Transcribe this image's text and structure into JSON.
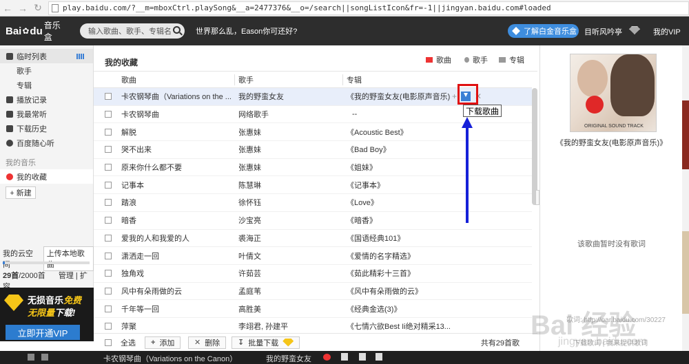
{
  "browser": {
    "url": "play.baidu.com/?__m=mboxCtrl.playSong&__a=2477376&__o=/search||songListIcon&fr=-1||jingyan.baidu.com#loaded"
  },
  "topbar": {
    "logo_text": "Bai",
    "logo_text2": "du",
    "logo_product": "音乐盒",
    "search_placeholder": "输入歌曲、歌手、专辑名",
    "hot_phrase": "世界那么乱，Eason你可还好?",
    "vip_pill": "了解白金音乐盒",
    "username": "目听风吟亭",
    "my_vip": "我的VIP"
  },
  "sidebar": {
    "items": [
      {
        "label": "临时列表"
      },
      {
        "label": "歌手"
      },
      {
        "label": "专辑"
      },
      {
        "label": "播放记录"
      },
      {
        "label": "我最常听"
      },
      {
        "label": "下载历史"
      },
      {
        "label": "百度随心听"
      }
    ],
    "my_music_label": "我的音乐",
    "favorites": "我的收藏",
    "new_button": "+ 新建",
    "cloud_label": "我的云空间",
    "upload_button": "上传本地歌曲",
    "cloud_count": "29首",
    "cloud_total": "/2000首",
    "manage": "管理",
    "expand": "扩容",
    "promo_line1": "无损音乐",
    "promo_line1_em": "免费",
    "promo_line2_em": "无限量",
    "promo_line2": "下载!",
    "promo_button": "立即开通VIP"
  },
  "main": {
    "title": "我的收藏",
    "tabs": [
      "歌曲",
      "歌手",
      "专辑"
    ],
    "columns": {
      "song": "歌曲",
      "artist": "歌手",
      "album": "专辑"
    },
    "rows": [
      {
        "song": "卡农钢琴曲（Variations on the ...",
        "artist": "我的野蛮女友",
        "album": "《我的野蛮女友(电影原声音乐)》"
      },
      {
        "song": "卡农钢琴曲",
        "artist": "网络歌手",
        "album": "--"
      },
      {
        "song": "解脱",
        "artist": "张惠妹",
        "album": "《Acoustic Best》"
      },
      {
        "song": "哭不出来",
        "artist": "张惠妹",
        "album": "《Bad Boy》"
      },
      {
        "song": "原来你什么都不要",
        "artist": "张惠妹",
        "album": "《姐妹》"
      },
      {
        "song": "记事本",
        "artist": "陈慧琳",
        "album": "《记事本》"
      },
      {
        "song": "踏浪",
        "artist": "徐怀钰",
        "album": "《Love》"
      },
      {
        "song": "暗香",
        "artist": "沙宝亮",
        "album": "《暗香》"
      },
      {
        "song": "爱我的人和我爱的人",
        "artist": "裘海正",
        "album": "《国语经典101》"
      },
      {
        "song": "潇洒走一回",
        "artist": "叶倩文",
        "album": "《爱情的名字精选》"
      },
      {
        "song": "独角戏",
        "artist": "许茹芸",
        "album": "《茹此精彩十三首》"
      },
      {
        "song": "风中有朵雨做的云",
        "artist": "孟庭苇",
        "album": "《风中有朵雨做的云》"
      },
      {
        "song": "千年等一回",
        "artist": "高胜美",
        "album": "《经典金选(3)》"
      },
      {
        "song": "萍聚",
        "artist": "李翊君, 孙建平",
        "album": "《七情六欲Best Ii绝对精采13..."
      }
    ],
    "tooltip": "下载歌曲",
    "bottom": {
      "select_all": "全选",
      "add": "添加",
      "delete": "删除",
      "batch_download": "批量下载",
      "total": "共有29首歌"
    }
  },
  "right_panel": {
    "cover_caption": "ORIGINAL SOUND TRACK",
    "album_name": "《我的野蛮女友(电影原声音乐)》",
    "no_lyrics": "该歌曲暂时没有歌词",
    "lyric_info": "歌词: http://oar.baidu.com/30227",
    "lyric_links": "下载歌词 | 我来提供歌词"
  },
  "player": {
    "now_playing": "卡农钢琴曲（Variations on the Canon）",
    "artist": "我的野蛮女友"
  },
  "watermark": {
    "main": "Bai 经验",
    "sub": "jingyan.baidu.com"
  }
}
